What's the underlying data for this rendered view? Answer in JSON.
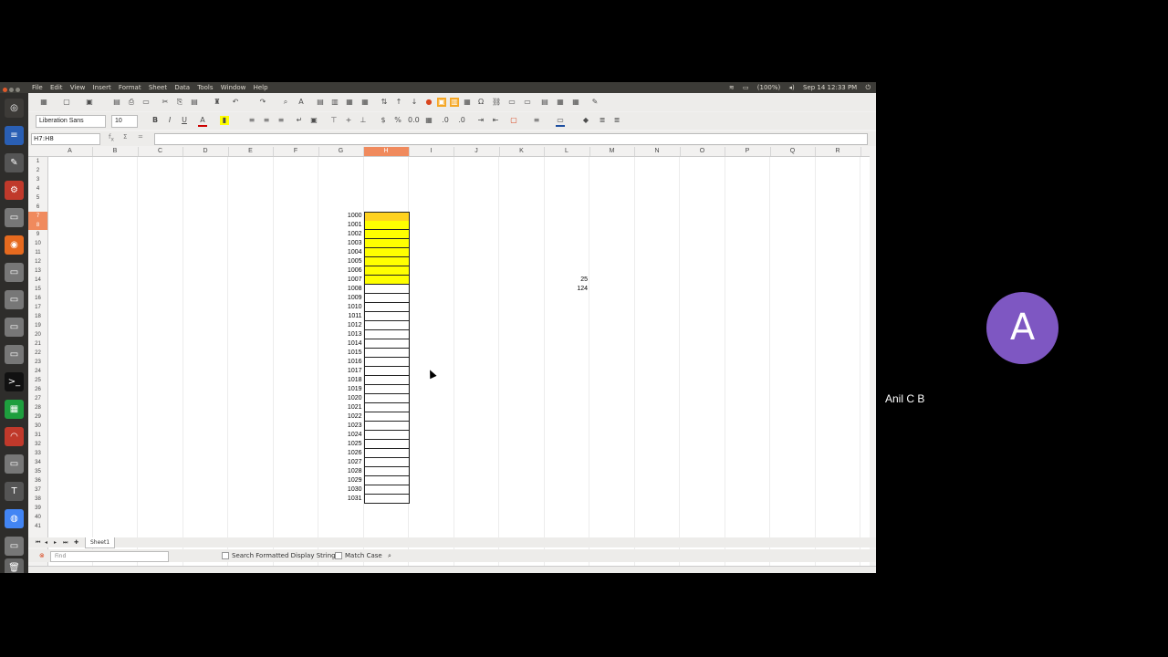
{
  "menubar": {
    "items": [
      "File",
      "Edit",
      "View",
      "Insert",
      "Format",
      "Sheet",
      "Data",
      "Tools",
      "Window",
      "Help"
    ],
    "tray": [
      "(100%)",
      "Sep 14 12:33 PM"
    ]
  },
  "toolbar": {
    "font_name": "Liberation Sans",
    "font_size": "10",
    "bold": "B",
    "italic": "I",
    "underline": "U"
  },
  "formula_bar": {
    "name_box": "H7:H8",
    "formula": ""
  },
  "columns": [
    "A",
    "B",
    "C",
    "D",
    "E",
    "F",
    "G",
    "H",
    "I",
    "J",
    "K",
    "L",
    "M",
    "N",
    "O",
    "P",
    "Q",
    "R"
  ],
  "selected_column": "H",
  "rows": [
    "1",
    "2",
    "3",
    "4",
    "5",
    "6",
    "7",
    "8",
    "9",
    "10",
    "11",
    "12",
    "13",
    "14",
    "15",
    "16",
    "17",
    "18",
    "19",
    "20",
    "21",
    "22",
    "23",
    "24",
    "25",
    "26",
    "27",
    "28",
    "29",
    "30",
    "31",
    "32",
    "33",
    "34",
    "35",
    "36",
    "37",
    "38",
    "39",
    "40",
    "41"
  ],
  "selected_rows": [
    "7",
    "8"
  ],
  "column_g_values": [
    "1000",
    "1001",
    "1002",
    "1003",
    "1004",
    "1005",
    "1006",
    "1007",
    "1008",
    "1009",
    "1010",
    "1011",
    "1012",
    "1013",
    "1014",
    "1015",
    "1016",
    "1017",
    "1018",
    "1019",
    "1020",
    "1021",
    "1022",
    "1023",
    "1024",
    "1025",
    "1026",
    "1027",
    "1028",
    "1029",
    "1030",
    "1031"
  ],
  "column_l_values": [
    {
      "row": "14",
      "value": "25"
    },
    {
      "row": "15",
      "value": "124"
    }
  ],
  "sheet_tabs": [
    "Sheet1"
  ],
  "find_bar": {
    "placeholder": "Find",
    "search_formatted": "Search Formatted Display String",
    "match_case": "Match Case"
  },
  "participant": {
    "initial": "A",
    "name": "Anil C B",
    "avatar_color": "#7e57c2"
  },
  "colors": {
    "highlight_yellow": "#ffff00",
    "selected_header": "#f08a5d"
  }
}
